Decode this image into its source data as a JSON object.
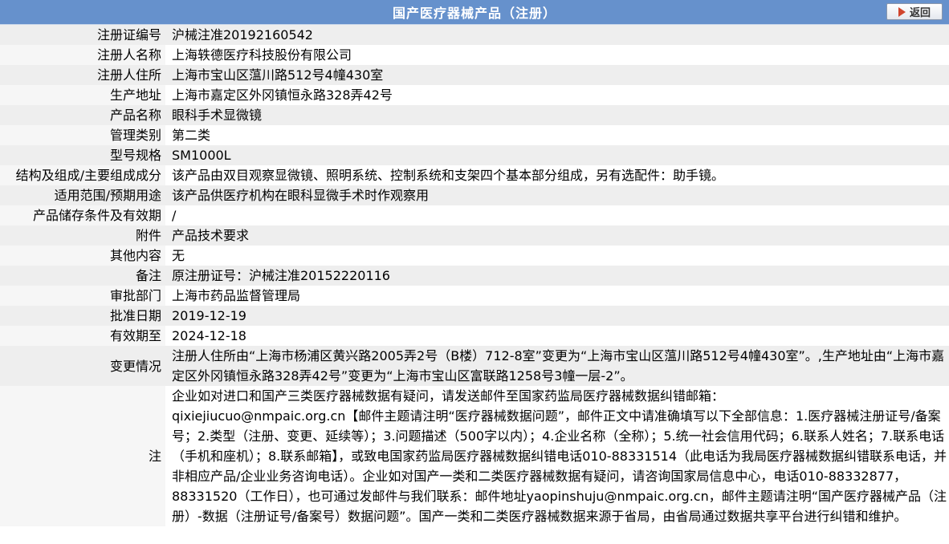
{
  "header": {
    "title": "国产医疗器械产品（注册）",
    "back_label": "返回"
  },
  "fields": [
    {
      "label": "注册证编号",
      "value": "沪械注准20192160542"
    },
    {
      "label": "注册人名称",
      "value": "上海轶德医疗科技股份有限公司"
    },
    {
      "label": "注册人住所",
      "value": "上海市宝山区蕰川路512号4幢430室"
    },
    {
      "label": "生产地址",
      "value": "上海市嘉定区外冈镇恒永路328弄42号"
    },
    {
      "label": "产品名称",
      "value": "眼科手术显微镜"
    },
    {
      "label": "管理类别",
      "value": "第二类"
    },
    {
      "label": "型号规格",
      "value": "SM1000L"
    },
    {
      "label": "结构及组成/主要组成成分",
      "value": "该产品由双目观察显微镜、照明系统、控制系统和支架四个基本部分组成，另有选配件：助手镜。"
    },
    {
      "label": "适用范围/预期用途",
      "value": "该产品供医疗机构在眼科显微手术时作观察用"
    },
    {
      "label": "产品储存条件及有效期",
      "value": "/"
    },
    {
      "label": "附件",
      "value": "产品技术要求"
    },
    {
      "label": "其他内容",
      "value": "无"
    },
    {
      "label": "备注",
      "value": "原注册证号：沪械注准20152220116"
    },
    {
      "label": "审批部门",
      "value": "上海市药品监督管理局"
    },
    {
      "label": "批准日期",
      "value": "2019-12-19"
    },
    {
      "label": "有效期至",
      "value": "2024-12-18"
    }
  ],
  "change": {
    "label": "变更情况",
    "value": "注册人住所由“上海市杨浦区黄兴路2005弄2号（B楼）712-8室”变更为“上海市宝山区蕰川路512号4幢430室”。,生产地址由“上海市嘉定区外冈镇恒永路328弄42号”变更为“上海市宝山区富联路1258号3幢一层-2”。"
  },
  "note": {
    "label": "注",
    "p1": "企业如对进口和国产三类医疗器械数据有疑问，请发送邮件至国家药监局医疗器械数据纠错邮箱：",
    "p2": "qixiejiucuo@nmpaic.org.cn【邮件主题请注明“医疗器械数据问题”，邮件正文中请准确填写以下全部信息：1.医疗器械注册证号/备案号；2.类型（注册、变更、延续等）；3.问题描述（500字以内）；4.企业名称（全称）；5.统一社会信用代码；6.联系人姓名；7.联系电话（手机和座机）；8.联系邮箱】，或致电国家药监局医疗器械数据纠错电话010-88331514（此电话为我局医疗器械数据纠错联系电话，并非相应产品/企业业务咨询电话）。企业如对国产一类和二类医疗器械数据有疑问，请咨询国家局信息中心，电话010-88332877，88331520（工作日），也可通过发邮件与我们联系：邮件地址yaopinshuju@nmpaic.org.cn，邮件主题请注明“国产医疗器械产品（注册）-数据（注册证号/备案号）数据问题”。国产一类和二类医疗器械数据来源于省局，由省局通过数据共享平台进行纠错和维护。"
  }
}
